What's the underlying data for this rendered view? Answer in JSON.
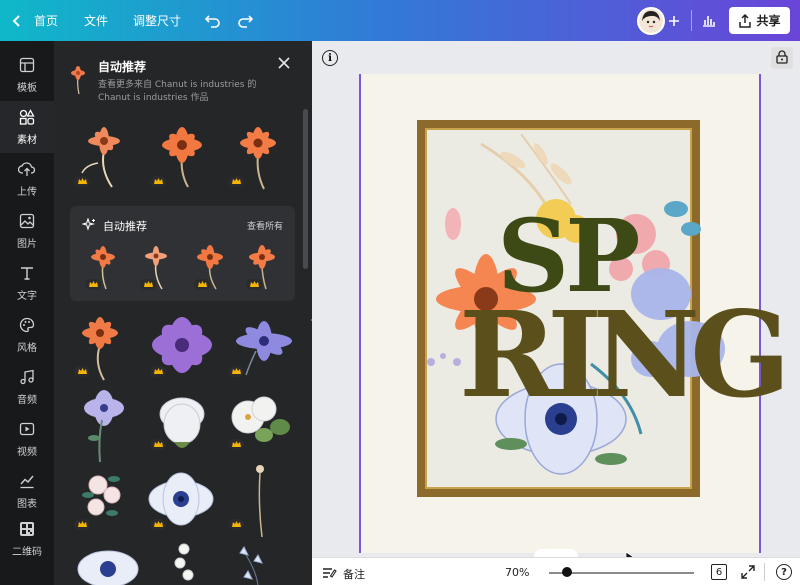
{
  "topbar": {
    "home": "首页",
    "file": "文件",
    "resize": "调整尺寸",
    "share": "共享"
  },
  "rail": [
    {
      "label": "模板",
      "icon": "template-icon"
    },
    {
      "label": "素材",
      "icon": "elements-icon"
    },
    {
      "label": "上传",
      "icon": "upload-icon"
    },
    {
      "label": "图片",
      "icon": "photo-icon"
    },
    {
      "label": "文字",
      "icon": "text-icon"
    },
    {
      "label": "风格",
      "icon": "palette-icon"
    },
    {
      "label": "音频",
      "icon": "music-icon"
    },
    {
      "label": "视频",
      "icon": "video-icon"
    },
    {
      "label": "图表",
      "icon": "chart-icon"
    },
    {
      "label": "二维码",
      "icon": "qrcode-icon"
    }
  ],
  "panel": {
    "title": "自动推荐",
    "subtitle": "查看更多来自 Chanut is industries 的 Chanut is industries 作品",
    "card_title": "自动推荐",
    "card_link": "查看所有"
  },
  "canvas": {
    "word_line1": "SP",
    "word_line2": "RING",
    "page_count": "6",
    "zoom": "70%"
  },
  "bottom": {
    "notes": "备注"
  },
  "colors": {
    "accent": "#7b56d6",
    "text_green": "#3d4a16",
    "frame": "#8c6a2c"
  }
}
